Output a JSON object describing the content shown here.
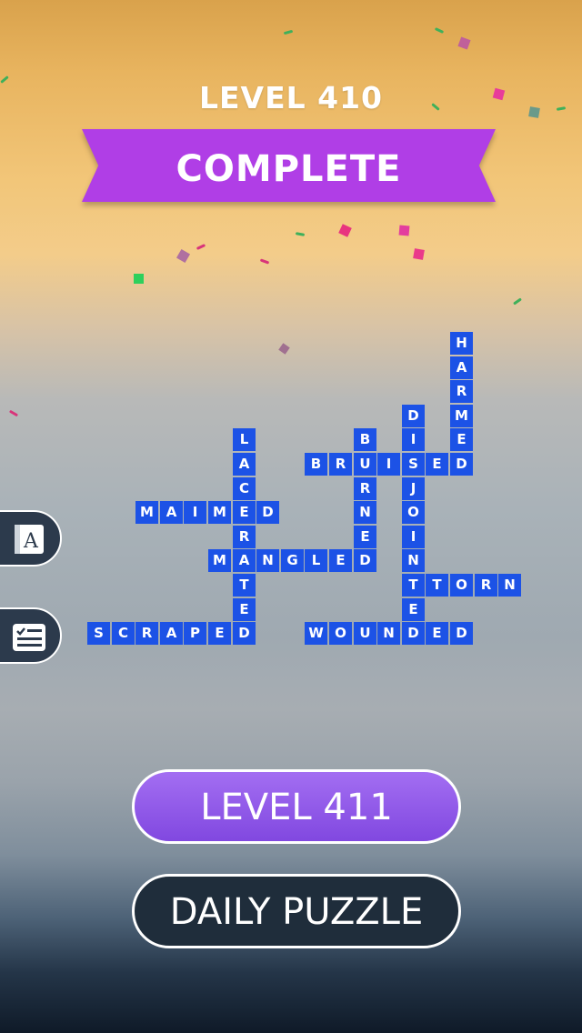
{
  "header": {
    "level_title": "LEVEL 410",
    "banner": "COMPLETE"
  },
  "colors": {
    "tile": "#1c52e6",
    "banner": "#b03ee6",
    "next_button": "#8a55e6",
    "daily_button": "#1f2d3b"
  },
  "words": [
    "HARMED",
    "BRUISED",
    "DISJOINTED",
    "LACERATED",
    "BURNED",
    "MAIMED",
    "MANGLED",
    "TORN",
    "SCRAPED",
    "WOUNDED"
  ],
  "sidebar": {
    "dictionary_icon": "dictionary-icon",
    "dictionary_letter": "A",
    "tasks_icon": "checklist-icon"
  },
  "buttons": {
    "next_level": "LEVEL 411",
    "daily_puzzle": "DAILY PUZZLE"
  }
}
